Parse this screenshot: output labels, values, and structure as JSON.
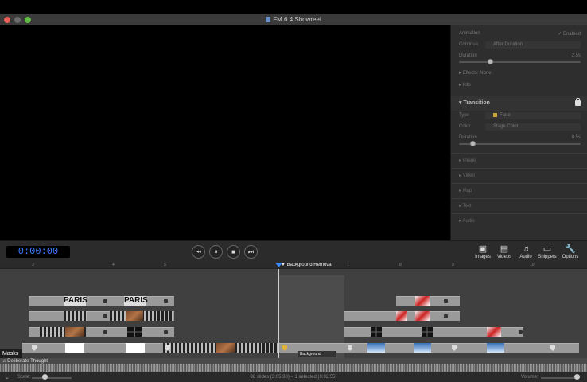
{
  "window": {
    "title": "FM 6.4 Showreel"
  },
  "inspector": {
    "animation": {
      "label": "Animation",
      "value": "Enabled"
    },
    "continue": {
      "label": "Continue",
      "value": "After Duration"
    },
    "duration": {
      "label": "Duration",
      "value": "2.5s"
    },
    "effects": {
      "label": "Effects",
      "value": "None"
    },
    "info": {
      "label": "Info"
    },
    "transition": {
      "header": "Transition",
      "type": {
        "label": "Type",
        "value": "Fade"
      },
      "color": {
        "label": "Color",
        "value": "Stage Color"
      },
      "duration": {
        "label": "Duration",
        "value": "0.5s"
      }
    },
    "sections": [
      "Image",
      "Video",
      "Map",
      "Text",
      "Audio"
    ]
  },
  "controls": {
    "timecode": "0:00:00",
    "toolbox": [
      {
        "label": "Images",
        "icon": "images-icon"
      },
      {
        "label": "Videos",
        "icon": "videos-icon"
      },
      {
        "label": "Audio",
        "icon": "audio-icon"
      },
      {
        "label": "Snippets",
        "icon": "snippets-icon"
      },
      {
        "label": "Options",
        "icon": "wrench-icon"
      }
    ]
  },
  "timeline": {
    "ruler_ticks": [
      "3",
      "4",
      "5",
      "7",
      "8",
      "9",
      "10"
    ],
    "marker_label": "Background Removal",
    "masks_label": "Masks",
    "bg_removal_clip_label": "Background Removal",
    "paris_text": "PARIS",
    "audio_track_label": "Deliberate Thought"
  },
  "statusbar": {
    "scale_label": "Scale:",
    "summary": "38 slides (3:05:30) – 1 selected (0:02:55)",
    "volume_label": "Volume:"
  },
  "colors": {
    "accent": "#3c8cff",
    "timecode": "#3c7cff"
  }
}
